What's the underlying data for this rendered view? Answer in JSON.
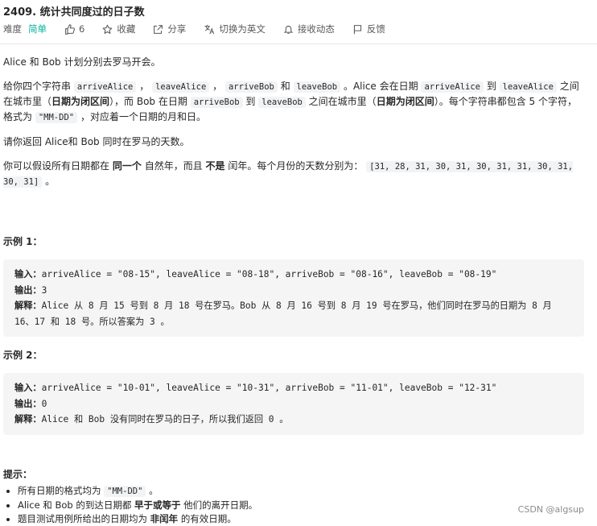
{
  "problem": {
    "title": "2409. 统计共同度过的日子数"
  },
  "toolbar": {
    "difficulty_label": "难度",
    "difficulty_value": "简单",
    "likes": "6",
    "favorite": "收藏",
    "share": "分享",
    "switch_lang": "切换为英文",
    "notifications": "接收动态",
    "feedback": "反馈",
    "icons": {
      "likes": "thumbs-up-icon",
      "favorite": "star-icon",
      "share": "share-icon",
      "switch_lang": "translate-icon",
      "notifications": "bell-icon",
      "feedback": "flag-icon"
    },
    "difficulty_color": "#00af9b"
  },
  "description": {
    "p1": "Alice 和 Bob 计划分别去罗马开会。",
    "p2": {
      "a": "给你四个字符串",
      "code1": "arriveAlice",
      "sep1": "，",
      "code2": "leaveAlice",
      "sep2": "，",
      "code3": "arriveBob",
      "b": "和",
      "code4": "leaveBob",
      "c": "。Alice 会在日期",
      "code5": "arriveAlice",
      "d": "到",
      "code6": "leaveAlice",
      "e": "之间在城市里（",
      "bold1": "日期为闭区间",
      "f": "），而 Bob 在日期",
      "code7": "arriveBob",
      "g": "到",
      "code8": "leaveBob",
      "h": "之间在城市里（",
      "bold2": "日期为闭区间",
      "i": "）。每个字符串都包含 5 个字符，格式为",
      "code9": "\"MM-DD\"",
      "j": "，对应着一个日期的月和日。"
    },
    "p3": "请你返回 Alice和 Bob 同时在罗马的天数。",
    "p4": {
      "a": "你可以假设所有日期都在",
      "bold1": "同一个",
      "b": "自然年，而且",
      "bold2": "不是",
      "c": "闰年。每个月份的天数分别为：",
      "code": "[31, 28, 31, 30, 31, 30, 31, 31, 30, 31, 30, 31]",
      "d": "。"
    }
  },
  "examples": [
    {
      "title": "示例 1：",
      "input_label": "输入：",
      "input": "arriveAlice = \"08-15\", leaveAlice = \"08-18\", arriveBob = \"08-16\", leaveBob = \"08-19\"",
      "output_label": "输出：",
      "output": "3",
      "explain_label": "解释：",
      "explain": "Alice 从 8 月 15 号到 8 月 18 号在罗马。Bob 从 8 月 16 号到 8 月 19 号在罗马，他们同时在罗马的日期为 8 月 16、17 和 18 号。所以答案为 3 。"
    },
    {
      "title": "示例 2：",
      "input_label": "输入：",
      "input": "arriveAlice = \"10-01\", leaveAlice = \"10-31\", arriveBob = \"11-01\", leaveBob = \"12-31\"",
      "output_label": "输出：",
      "output": "0",
      "explain_label": "解释：",
      "explain": "Alice 和 Bob 没有同时在罗马的日子，所以我们返回 0 。"
    }
  ],
  "hints": {
    "title": "提示：",
    "h1": {
      "a": "所有日期的格式均为",
      "code": "\"MM-DD\"",
      "b": "。"
    },
    "h2": {
      "a": "Alice 和 Bob 的到达日期都",
      "bold": "早于或等于",
      "b": "他们的离开日期。"
    },
    "h3": {
      "a": "题目测试用例所给出的日期均为",
      "bold": "非闰年",
      "b": "的有效日期。"
    }
  },
  "watermark": "CSDN @algsup"
}
